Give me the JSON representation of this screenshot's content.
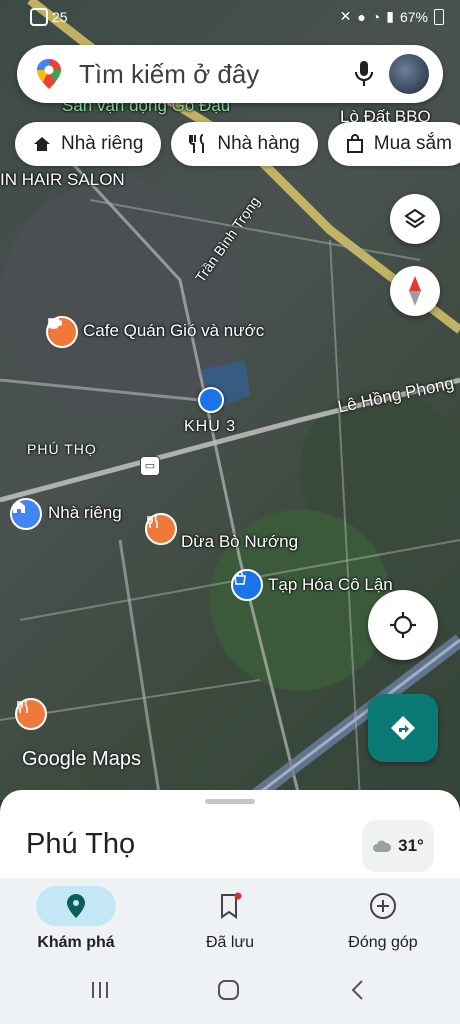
{
  "status": {
    "time": "25",
    "battery": "67%"
  },
  "search": {
    "placeholder": "Tìm kiếm ở đây"
  },
  "chips": [
    {
      "label": "Nhà riêng",
      "icon": "home-icon"
    },
    {
      "label": "Nhà hàng",
      "icon": "restaurant-icon"
    },
    {
      "label": "Mua sắm",
      "icon": "shopping-bag-icon"
    }
  ],
  "map": {
    "labels": {
      "stadium": "Sân vận động Gò Đậu",
      "bbq": "Lò Đất BBQ",
      "hair_salon": "IN HAIR SALON",
      "road1": "Trần Bình Trọng",
      "cafe": "Cafe Quán Gió và nước",
      "road2": "Lê Hồng Phong",
      "area": "KHU 3",
      "district": "PHÚ THỌ",
      "home": "Nhà riêng",
      "restaurant_line1": "Dừa Bò Nướng",
      "grocery": "Tạp Hóa Cô Lận",
      "attribution": "Google Maps"
    }
  },
  "sheet": {
    "place": "Phú Thọ",
    "temperature": "31°"
  },
  "bottom_nav": [
    {
      "label": "Khám phá",
      "icon": "explore-pin-icon",
      "active": true
    },
    {
      "label": "Đã lưu",
      "icon": "bookmark-icon",
      "active": false
    },
    {
      "label": "Đóng góp",
      "icon": "add-circle-icon",
      "active": false
    }
  ],
  "colors": {
    "accent": "#0b7a75",
    "active_nav": "#c4e7f5",
    "location_dot": "#1a73e8"
  }
}
